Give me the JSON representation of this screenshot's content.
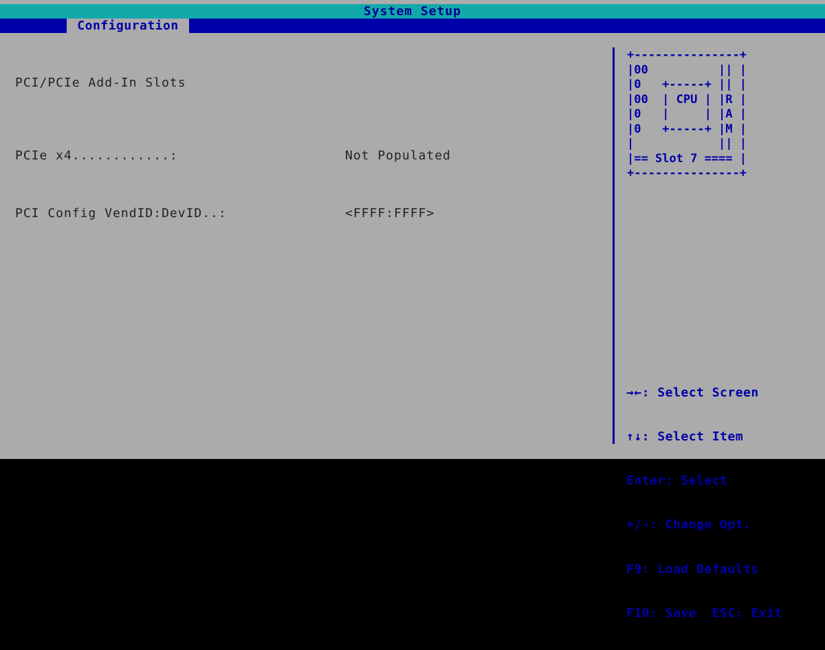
{
  "title": "System Setup",
  "tabs": [
    {
      "label": "Configuration",
      "active": true
    }
  ],
  "main": {
    "section_title": "PCI/PCIe Add-In Slots",
    "rows": [
      {
        "label": "PCIe x4............:",
        "value": "Not Populated"
      },
      {
        "label": "PCI Config VendID:DevID..:",
        "value": "<FFFF:FFFF>"
      }
    ]
  },
  "diagram": {
    "lines": [
      "+---------------+",
      "|00          || |",
      "|0   +-----+ || |",
      "|00  | CPU | |R |",
      "|0   |     | |A |",
      "|0   +-----+ |M |",
      "|            || |",
      "|== Slot 7 ==== |",
      "+---------------+"
    ]
  },
  "help": {
    "items": [
      "→←: Select Screen",
      "↑↓: Select Item",
      "Enter: Select",
      "+/-: Change Opt.",
      "F9: Load Defaults",
      "F10: Save  ESC: Exit"
    ]
  },
  "colors": {
    "background": "#ababab",
    "title_bar": "#12a9ab",
    "accent_blue": "#0000a8",
    "text": "#222222"
  }
}
